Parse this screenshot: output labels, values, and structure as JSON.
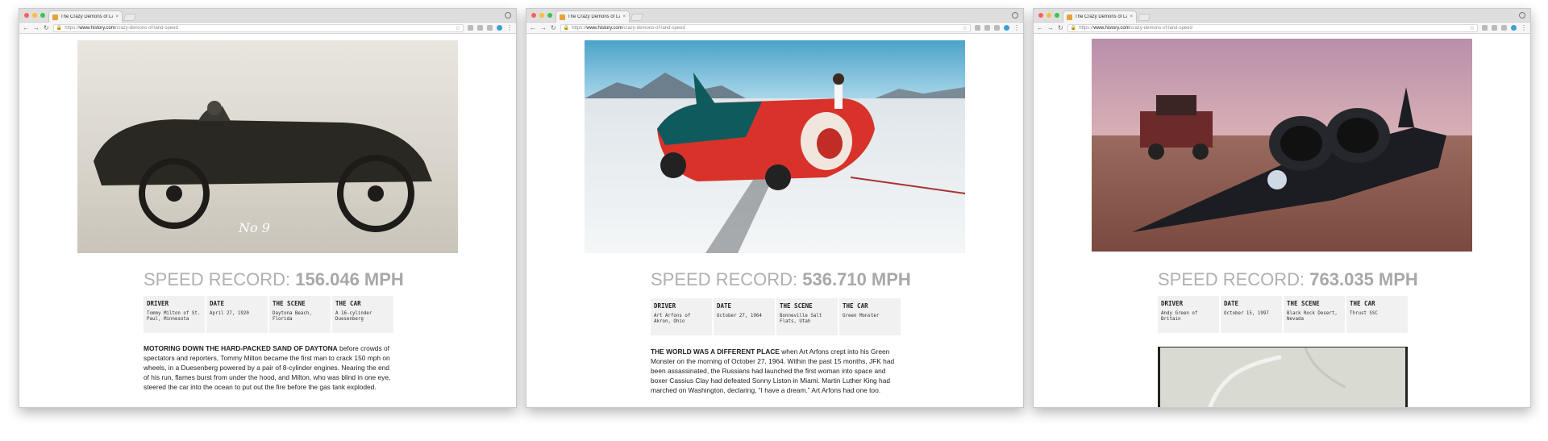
{
  "windows": [
    {
      "tab_title": "The Crazy Demons of Land-Sp",
      "url_scheme": "https://",
      "url_host": "www.history.com",
      "url_path": "/crazy-demons-of-land-speed",
      "photo": "1920 Duesenberg race car No 9 with driver",
      "record_label": "SPEED RECORD:",
      "record_value": "156.046 MPH",
      "facts": [
        {
          "label": "DRIVER",
          "value": "Tommy Milton of St. Paul, Minnesota"
        },
        {
          "label": "DATE",
          "value": "April 27, 1920"
        },
        {
          "label": "THE SCENE",
          "value": "Daytona Beach, Florida"
        },
        {
          "label": "THE CAR",
          "value": "A 16-cylinder Duesenberg"
        }
      ],
      "lead": "MOTORING DOWN THE HARD-PACKED SAND OF DAYTONA",
      "body": " before crowds of spectators and reporters, Tommy Milton became the first man to crack 150 mph on wheels, in a Duesenberg powered by a pair of 8-cylinder engines. Nearing the end of his run, flames burst from under the hood, and Milton, who was blind in one eye, steered the car into the ocean to put out the fire before the gas tank exploded."
    },
    {
      "tab_title": "The Crazy Demons of Land-Sp",
      "url_scheme": "https://",
      "url_host": "www.history.com",
      "url_path": "/crazy-demons-of-land-speed",
      "photo": "Green Monster jet car on salt flats with driver",
      "record_label": "SPEED RECORD:",
      "record_value": "536.710 MPH",
      "facts": [
        {
          "label": "DRIVER",
          "value": "Art Arfons of Akron, Ohio"
        },
        {
          "label": "DATE",
          "value": "October 27, 1964"
        },
        {
          "label": "THE SCENE",
          "value": "Bonneville Salt Flats, Utah"
        },
        {
          "label": "THE CAR",
          "value": "Green Monster"
        }
      ],
      "lead": "THE WORLD WAS A DIFFERENT PLACE",
      "body": " when Art Arfons crept into his Green Monster on the morning of October 27, 1964. Within the past 15 months, JFK had been assassinated, the Russians had launched the first woman into space and boxer Cassius Clay had defeated Sonny Liston in Miami. Martin Luther King had marched on Washington, declaring, “I have a dream.” Art Arfons had one too."
    },
    {
      "tab_title": "The Crazy Demons of Land-Sp",
      "url_scheme": "https://",
      "url_host": "www.history.com",
      "url_path": "/crazy-demons-of-land-speed",
      "photo": "Thrust SSC jet car in Black Rock Desert",
      "record_label": "SPEED RECORD:",
      "record_value": "763.035 MPH",
      "facts": [
        {
          "label": "DRIVER",
          "value": "Andy Green of Britain"
        },
        {
          "label": "DATE",
          "value": "October 15, 1997"
        },
        {
          "label": "THE SCENE",
          "value": "Black Rock Desert, Nevada"
        },
        {
          "label": "THE CAR",
          "value": "Thrust SSC"
        }
      ]
    }
  ]
}
